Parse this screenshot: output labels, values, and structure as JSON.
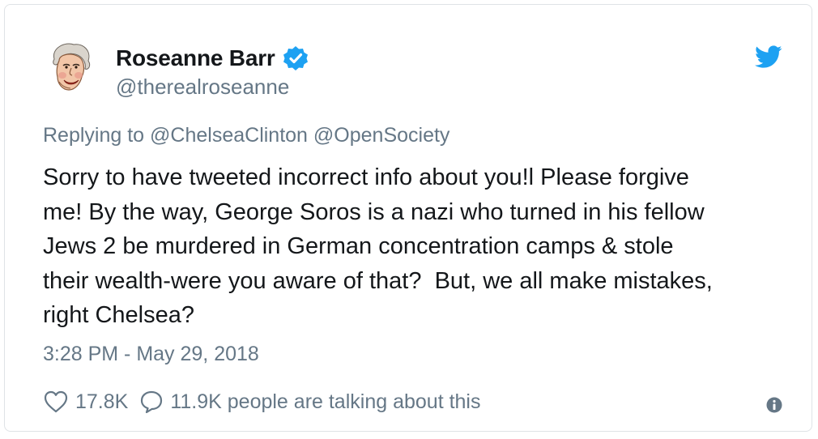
{
  "author": {
    "display_name": "Roseanne Barr",
    "handle": "@therealroseanne",
    "verified_icon": "verified-badge-icon",
    "avatar_icon": "avatar-caricature"
  },
  "brand": {
    "icon": "twitter-bird-icon",
    "color": "#1da1f2"
  },
  "reply": {
    "prefix": "Replying to",
    "mentions": [
      "@ChelseaClinton",
      "@OpenSociety"
    ]
  },
  "tweet": {
    "text": "Sorry to have tweeted incorrect info about you!l Please forgive\nme! By the way, George Soros is a nazi who turned in his fellow\nJews 2 be murdered in German concentration camps & stole\ntheir wealth-were you aware of that?  But, we all make mistakes,\nright Chelsea?",
    "timestamp": "3:28 PM - May 29, 2018"
  },
  "actions": {
    "likes": "17.8K",
    "like_icon": "heart-icon",
    "conversation": "11.9K people are talking about this",
    "conversation_icon": "reply-bubble-icon",
    "info_icon": "info-icon"
  },
  "colors": {
    "text": "#14171a",
    "secondary": "#657786",
    "border": "#dfe3e6",
    "verified": "#1da1f2"
  }
}
